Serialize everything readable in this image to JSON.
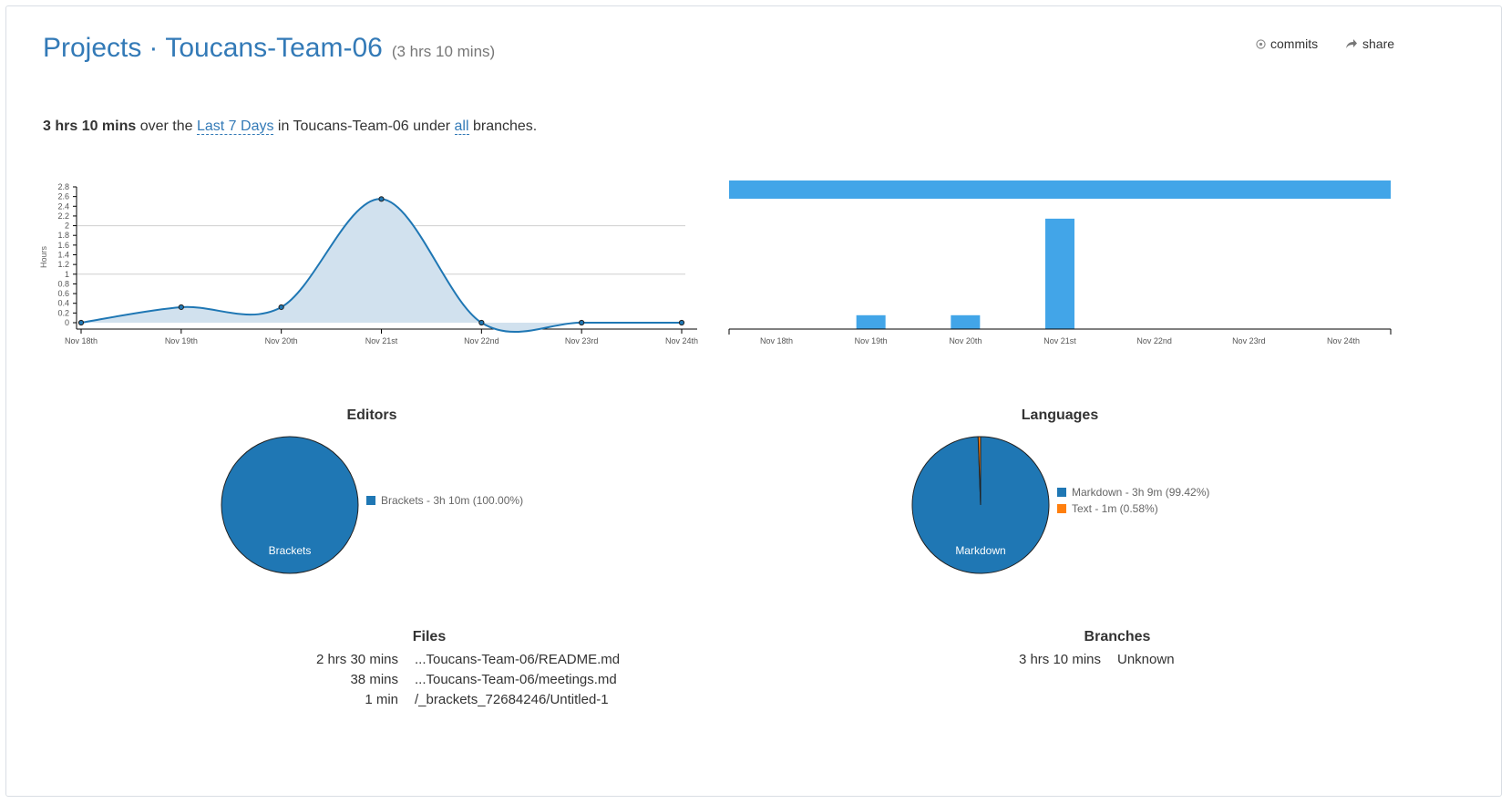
{
  "header": {
    "projects": "Projects",
    "separator": "·",
    "project": "Toucans-Team-06",
    "duration": "(3 hrs 10 mins)",
    "commits_label": "commits",
    "share_label": "share"
  },
  "summary": {
    "total": "3 hrs 10 mins",
    "t1": " over the ",
    "range": "Last 7 Days",
    "t2": " in Toucans-Team-06 under ",
    "branches_link": "all",
    "t3": " branches."
  },
  "chart_data": [
    {
      "type": "area",
      "ylabel": "Hours",
      "categories": [
        "Nov 18th",
        "Nov 19th",
        "Nov 20th",
        "Nov 21st",
        "Nov 22nd",
        "Nov 23rd",
        "Nov 24th"
      ],
      "yticks": [
        "0",
        "0.2",
        "0.4",
        "0.6",
        "0.8",
        "1",
        "1.2",
        "1.4",
        "1.6",
        "1.8",
        "2",
        "2.2",
        "2.4",
        "2.6",
        "2.8"
      ],
      "ylim": [
        0,
        2.8
      ],
      "values": [
        0.0,
        0.32,
        0.32,
        2.55,
        0.0,
        0.0,
        0.0
      ],
      "color": "#1f77b4"
    },
    {
      "type": "bar",
      "categories": [
        "Nov 18th",
        "Nov 19th",
        "Nov 20th",
        "Nov 21st",
        "Nov 22nd",
        "Nov 23rd",
        "Nov 24th"
      ],
      "values": [
        0.0,
        0.32,
        0.32,
        2.55,
        0.0,
        0.0,
        0.0
      ],
      "ylim": [
        0,
        2.8
      ],
      "color": "#42a5e8"
    }
  ],
  "editors": {
    "title": "Editors",
    "slices": [
      {
        "label": "Brackets",
        "legend": "Brackets - 3h 10m (100.00%)",
        "percent": 100.0,
        "color": "#1f77b4"
      }
    ]
  },
  "languages": {
    "title": "Languages",
    "slices": [
      {
        "label": "Markdown",
        "legend": "Markdown - 3h 9m (99.42%)",
        "percent": 99.42,
        "color": "#1f77b4"
      },
      {
        "label": "",
        "legend": "Text - 1m (0.58%)",
        "percent": 0.58,
        "color": "#ff7f0e"
      }
    ]
  },
  "files": {
    "title": "Files",
    "rows": [
      {
        "duration": "2 hrs 30 mins",
        "name": "...Toucans-Team-06/README.md"
      },
      {
        "duration": "38 mins",
        "name": "...Toucans-Team-06/meetings.md"
      },
      {
        "duration": "1 min",
        "name": "/_brackets_72684246/Untitled-1"
      }
    ]
  },
  "branches": {
    "title": "Branches",
    "rows": [
      {
        "duration": "3 hrs 10 mins",
        "name": "Unknown"
      }
    ]
  }
}
